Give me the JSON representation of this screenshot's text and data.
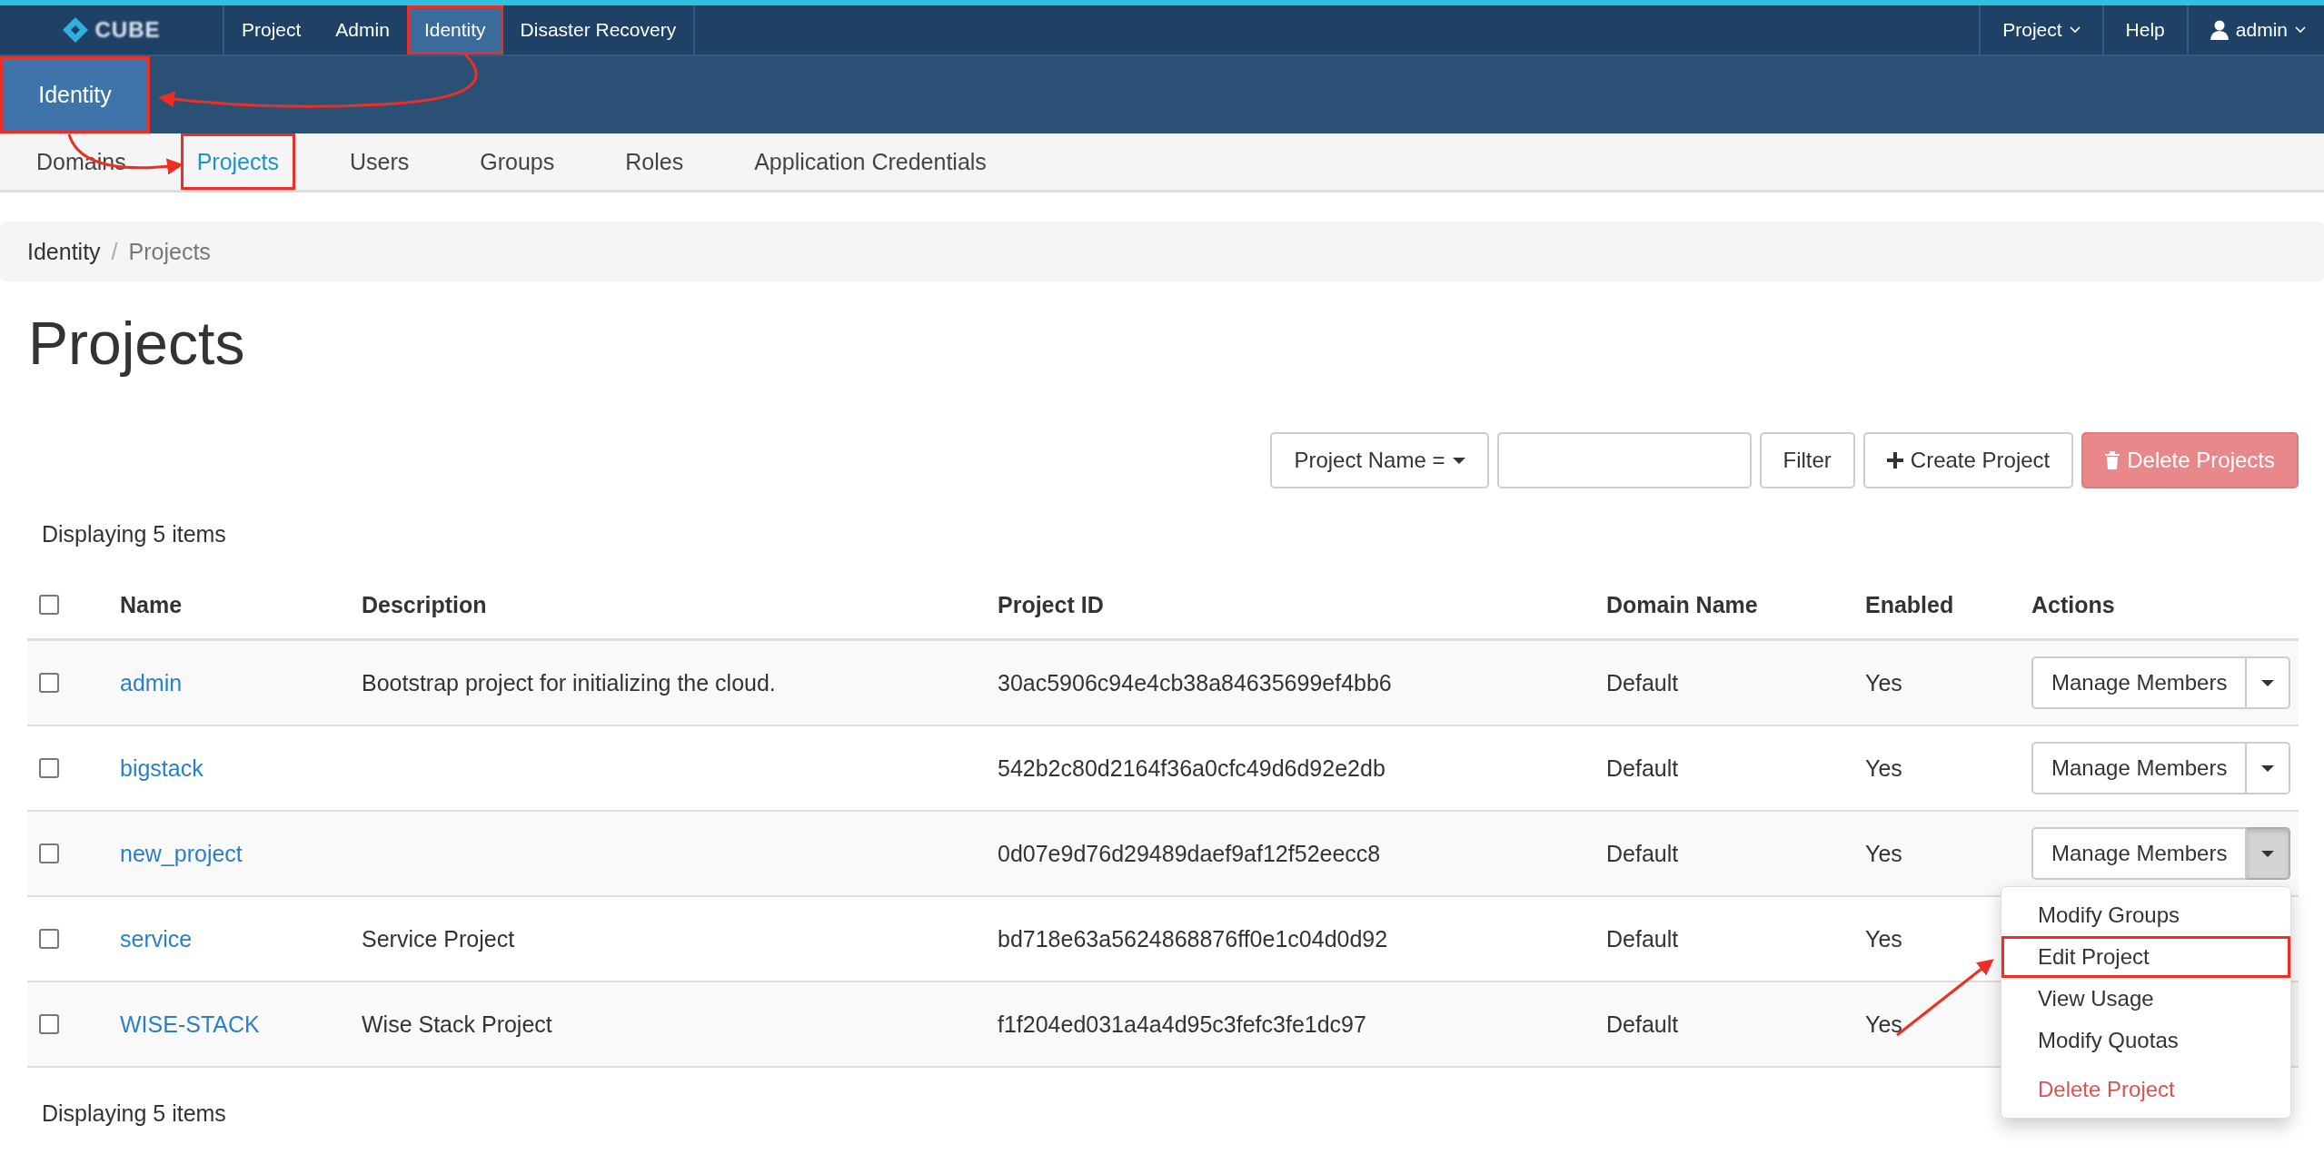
{
  "brand": {
    "name": "CUBE"
  },
  "nav": [
    {
      "label": "Project",
      "selected": false,
      "highlighted": false
    },
    {
      "label": "Admin",
      "selected": false,
      "highlighted": false
    },
    {
      "label": "Identity",
      "selected": true,
      "highlighted": true
    },
    {
      "label": "Disaster Recovery",
      "selected": false,
      "highlighted": false
    }
  ],
  "nav_right": [
    {
      "label": "Project",
      "kind": "dropdown"
    },
    {
      "label": "Help",
      "kind": "link"
    },
    {
      "label": "admin",
      "kind": "user"
    }
  ],
  "panel": {
    "label": "Identity",
    "highlighted": true
  },
  "tabs": [
    {
      "label": "Domains",
      "selected": false,
      "highlighted": false
    },
    {
      "label": "Projects",
      "selected": true,
      "highlighted": true
    },
    {
      "label": "Users",
      "selected": false,
      "highlighted": false
    },
    {
      "label": "Groups",
      "selected": false,
      "highlighted": false
    },
    {
      "label": "Roles",
      "selected": false,
      "highlighted": false
    },
    {
      "label": "Application Credentials",
      "selected": false,
      "highlighted": false
    }
  ],
  "breadcrumb": [
    "Identity",
    "Projects"
  ],
  "breadcrumb_separator": "/",
  "page_title": "Projects",
  "toolbar": {
    "filter_select": "Project Name =",
    "filter_button": "Filter",
    "create_button": "Create Project",
    "delete_button": "Delete Projects",
    "delete_disabled": true
  },
  "count_top": "Displaying 5 items",
  "table": {
    "select_all_checked": false,
    "columns": [
      "Name",
      "Description",
      "Project ID",
      "Domain Name",
      "Enabled",
      "Actions"
    ],
    "rows": [
      {
        "checked": false,
        "name": "admin",
        "description": "Bootstrap project for initializing the cloud.",
        "project_id": "30ac5906c94e4cb38a84635699ef4bb6",
        "domain": "Default",
        "enabled": "Yes",
        "action": "Manage Members",
        "menu_open": false
      },
      {
        "checked": false,
        "name": "bigstack",
        "description": "",
        "project_id": "542b2c80d2164f36a0cfc49d6d92e2db",
        "domain": "Default",
        "enabled": "Yes",
        "action": "Manage Members",
        "menu_open": false
      },
      {
        "checked": false,
        "name": "new_project",
        "description": "",
        "project_id": "0d07e9d76d29489daef9af12f52eecc8",
        "domain": "Default",
        "enabled": "Yes",
        "action": "Manage Members",
        "menu_open": true
      },
      {
        "checked": false,
        "name": "service",
        "description": "Service Project",
        "project_id": "bd718e63a5624868876ff0e1c04d0d92",
        "domain": "Default",
        "enabled": "Yes"
      },
      {
        "checked": false,
        "name": "WISE-STACK",
        "description": "Wise Stack Project",
        "project_id": "f1f204ed031a4a4d95c3fefc3fe1dc97",
        "domain": "Default",
        "enabled": "Yes"
      }
    ]
  },
  "action_menu": [
    {
      "label": "Modify Groups",
      "kind": "normal",
      "highlighted": false
    },
    {
      "label": "Edit Project",
      "kind": "normal",
      "highlighted": true
    },
    {
      "label": "View Usage",
      "kind": "normal",
      "highlighted": false
    },
    {
      "label": "Modify Quotas",
      "kind": "normal",
      "highlighted": false
    },
    {
      "label": "Delete Project",
      "kind": "danger",
      "highlighted": false
    }
  ],
  "count_bottom": "Displaying 5 items"
}
